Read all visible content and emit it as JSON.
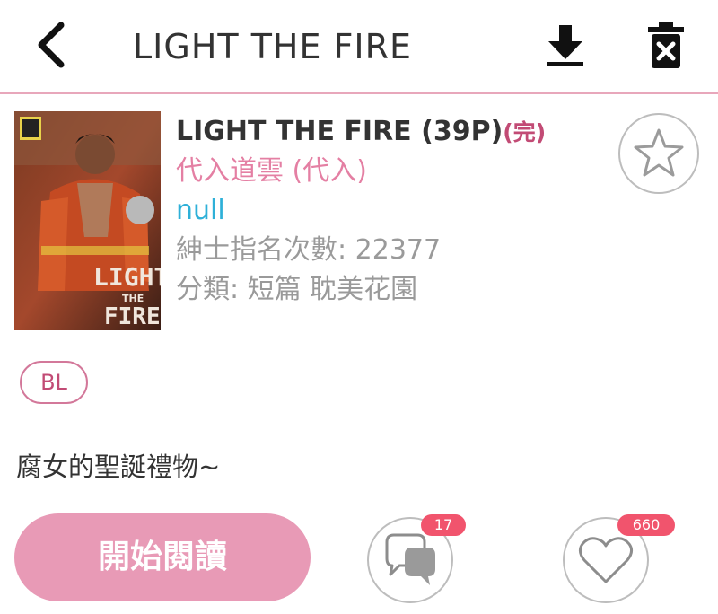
{
  "header": {
    "title": "LIGHT THE FIRE",
    "back_icon": "back-arrow-icon",
    "download_icon": "download-icon",
    "delete_icon": "trash-icon"
  },
  "book": {
    "title": "LIGHT THE FIRE (39P)",
    "status": "(完)",
    "author": "代入道雲 (代入)",
    "artist": "null",
    "views_line": "紳士指名次數: 22377",
    "category_line": "分類: 短篇 耽美花園",
    "cover_text_1": "LIGHT",
    "cover_text_2": "THE",
    "cover_text_3": "FIRE"
  },
  "tags": [
    "BL"
  ],
  "description": "腐女的聖誕禮物~",
  "actions": {
    "read_label": "開始閱讀",
    "comment_count": "17",
    "like_count": "660",
    "favorite_icon": "star-icon",
    "comment_icon": "comment-icon",
    "like_icon": "heart-icon"
  },
  "colors": {
    "accent_pink": "#e89ab6",
    "divider": "#e8a7bb",
    "author_pink": "#e47fa3",
    "artist_blue": "#2eb0d8",
    "badge_red": "#f1546d"
  }
}
